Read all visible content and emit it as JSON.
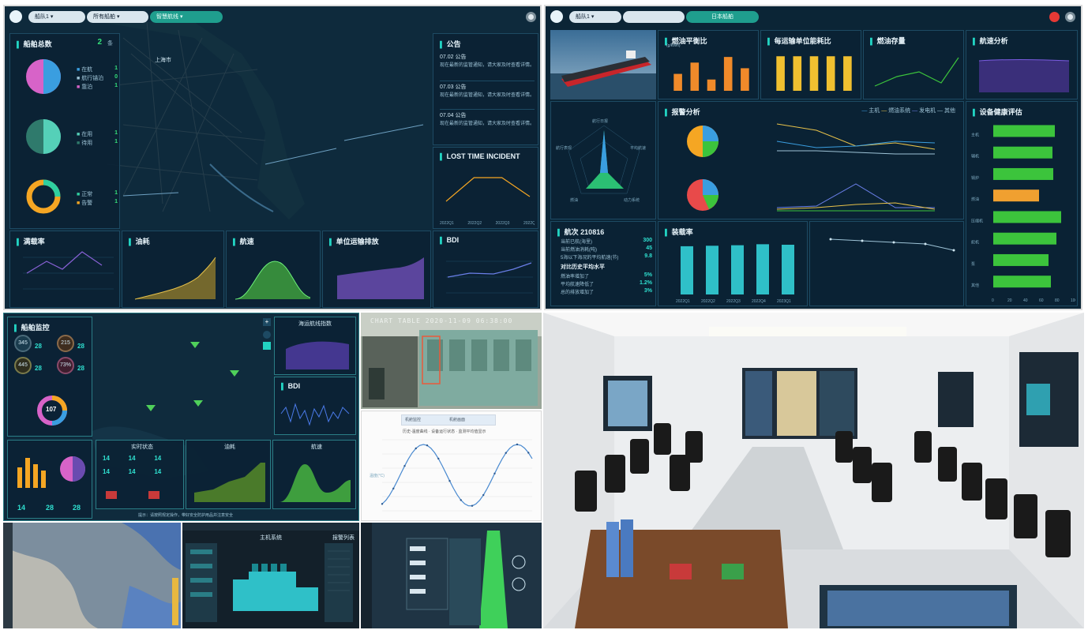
{
  "q1": {
    "fleet_select": "船队1",
    "ship_select": "所有船舶",
    "mode_button": "智慧航线",
    "map_label": "上海市",
    "fleet_panel": {
      "title": "船舶总数",
      "count": "2",
      "unit": "条"
    },
    "pie_groups": [
      {
        "items": [
          {
            "label": "在航",
            "count": "1"
          },
          {
            "label": "航行锚泊",
            "count": "0"
          },
          {
            "label": "靠泊",
            "count": "1"
          }
        ]
      },
      {
        "items": [
          {
            "label": "在用",
            "count": "1"
          },
          {
            "label": "待用",
            "count": "1"
          }
        ]
      },
      {
        "items": [
          {
            "label": "正常",
            "count": "1"
          },
          {
            "label": "告警",
            "count": "1"
          }
        ]
      }
    ],
    "unit_ship": "条",
    "notice": {
      "title": "公告",
      "items": [
        {
          "date": "07.02 公告",
          "text": "现在最新的监管通知，请大家及时查看详情。"
        },
        {
          "date": "07.03 公告",
          "text": "现在最新的监管通知，请大家及时查看详情。"
        },
        {
          "date": "07.04 公告",
          "text": "现在最新的监管通知，请大家及时查看详情。"
        }
      ]
    },
    "lti": {
      "title": "LOST TIME INCIDENT",
      "x": [
        "2022Q1",
        "2022Q2",
        "2022Q3",
        "2022Q4"
      ],
      "y": [
        3,
        8,
        8,
        4
      ]
    },
    "bottom_titles": [
      "满载率",
      "油耗",
      "航速",
      "单位运输排放",
      "BDI"
    ]
  },
  "q2": {
    "fleet_select": "船队1",
    "mode_button": "日本船舶",
    "fuel_title": "燃油平衡比",
    "fuel_unit": "(g/kWh)",
    "fuel_values": [
      3,
      5,
      2,
      6,
      4
    ],
    "energy_title": "每运输单位能耗比",
    "energy_values": [
      7,
      7,
      7,
      7,
      7
    ],
    "stock_title": "燃油存量",
    "speed_title": "航速分析",
    "alarm_title": "报警分析",
    "alarm_legend": [
      "主机",
      "燃油系统",
      "发电机",
      "其他"
    ],
    "radar_labels": [
      "航行日报",
      "平均航速",
      "动力系统",
      "燃油",
      "航行表现"
    ],
    "voyage": {
      "title": "航次 210816",
      "rows": [
        {
          "label": "当前已航(海里)",
          "value": "300"
        },
        {
          "label": "当前燃油消耗(吨)",
          "value": "45"
        },
        {
          "label": "5海以下海况的平均航速(节)",
          "value": "9.8"
        }
      ],
      "compare_title": "对比历史平均水平",
      "compare_rows": [
        {
          "label": "燃油率增加了",
          "value": "5%"
        },
        {
          "label": "平均航速降低了",
          "value": "1.2%"
        },
        {
          "label": "总的排放增加了",
          "value": "3%"
        }
      ]
    },
    "load_title": "装载率",
    "load_values": [
      96,
      97,
      98,
      100,
      99
    ],
    "load_x": [
      "2022Q1",
      "2022Q2",
      "2022Q3",
      "2022Q4",
      "2023Q1"
    ],
    "healthy_title": "设备健康评估",
    "health_rows": [
      {
        "label": "主机",
        "level": 0.78,
        "color": "#3cc43c"
      },
      {
        "label": "辅机",
        "level": 0.75,
        "color": "#3cc43c"
      },
      {
        "label": "锅炉",
        "level": 0.76,
        "color": "#3cc43c"
      },
      {
        "label": "燃油",
        "level": 0.58,
        "color": "#f0a030"
      },
      {
        "label": "压缩机",
        "level": 0.86,
        "color": "#3cc43c"
      },
      {
        "label": "舵机",
        "level": 0.8,
        "color": "#3cc43c"
      },
      {
        "label": "泵",
        "level": 0.7,
        "color": "#3cc43c"
      },
      {
        "label": "其他",
        "level": 0.73,
        "color": "#3cc43c"
      }
    ],
    "health_axis": [
      "0",
      "20",
      "40",
      "60",
      "80",
      "100"
    ]
  },
  "q3": {
    "title_left": "船舶监控",
    "circles": [
      {
        "value": "345",
        "sub": "28"
      },
      {
        "value": "215",
        "sub": "28"
      },
      {
        "value": "445",
        "sub": "28"
      },
      {
        "value": "73%",
        "sub": "28"
      }
    ],
    "donut_center": "107",
    "right_top_title": "海运航线指数",
    "right_mid_title": "BDI",
    "bottom_left_values": [
      "14",
      "28",
      "28"
    ],
    "grid_title": "实时状态",
    "grid_items": [
      "14",
      "14",
      "14",
      "14",
      "14",
      "14"
    ],
    "chart_titles": [
      "油耗",
      "航速"
    ],
    "footer_note": "提示：请按照规定操作，带好安全防护用品并注意安全"
  },
  "q4": {
    "cam_text": "CHART TABLE 2020-11-09 06:38:00",
    "cam_labels": [
      "机舱监控",
      "机舱画面"
    ],
    "sine_title": "历史-温度曲线 · 设备运行状态 · 监测平均值显示",
    "sine_ylabel": "温度(°C)"
  },
  "q5": {
    "engine_title": "主机系统",
    "engine_side_title": "报警列表"
  }
}
